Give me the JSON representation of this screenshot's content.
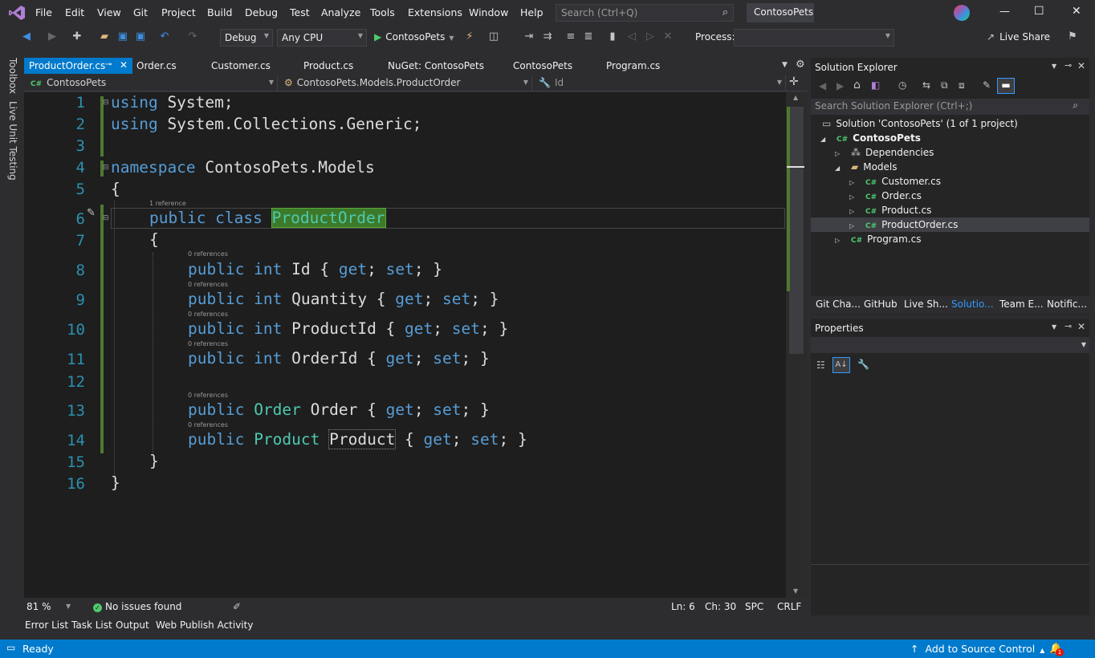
{
  "menu": {
    "items": [
      "File",
      "Edit",
      "View",
      "Git",
      "Project",
      "Build",
      "Debug",
      "Test",
      "Analyze",
      "Tools",
      "Extensions",
      "Window",
      "Help"
    ],
    "search_placeholder": "Search (Ctrl+Q)",
    "solution_name": "ContosoPets",
    "window_buttons": {
      "minimize": "—",
      "maximize": "☐",
      "close": "✕"
    }
  },
  "toolbar": {
    "configuration": "Debug",
    "platform": "Any CPU",
    "start_target": "ContosoPets",
    "process_label": "Process:",
    "process_value": "",
    "live_share": "Live Share"
  },
  "left_rail": {
    "toolbox": "Toolbox",
    "live_unit_testing": "Live Unit Testing"
  },
  "tabs": [
    "ProductOrder.cs",
    "Order.cs",
    "Customer.cs",
    "Product.cs",
    "NuGet: ContosoPets",
    "ContosoPets",
    "Program.cs"
  ],
  "navbar": {
    "project": "ContosoPets",
    "type": "ContosoPets.Models.ProductOrder",
    "member": "Id"
  },
  "code": {
    "line_numbers": [
      "1",
      "2",
      "3",
      "4",
      "5",
      "6",
      "7",
      "8",
      "9",
      "10",
      "11",
      "12",
      "13",
      "14",
      "15",
      "16"
    ],
    "refs": {
      "class": "1 reference",
      "id": "0 references",
      "quantity": "0 references",
      "productid": "0 references",
      "orderid": "0 references",
      "order": "0 references",
      "product": "0 references"
    },
    "lines": {
      "l1_kw": "using",
      "l1_rest": " System;",
      "l2_kw": "using",
      "l2_rest": " System.Collections.Generic;",
      "l4_kw": "namespace",
      "l4_rest": " ContosoPets.Models",
      "l5": "{",
      "l6_kw": "public class",
      "l6_name": "ProductOrder",
      "l7": "{",
      "l8_kw": "public int",
      "l8_name": " Id { ",
      "l8_get": "get",
      "l8_mid": "; ",
      "l8_set": "set",
      "l8_end": "; }",
      "l9_kw": "public int",
      "l9_name": " Quantity { ",
      "l9_get": "get",
      "l9_mid": "; ",
      "l9_set": "set",
      "l9_end": "; }",
      "l10_kw": "public int",
      "l10_name": " ProductId { ",
      "l10_get": "get",
      "l10_mid": "; ",
      "l10_set": "set",
      "l10_end": "; }",
      "l11_kw": "public int",
      "l11_name": " OrderId { ",
      "l11_get": "get",
      "l11_mid": "; ",
      "l11_set": "set",
      "l11_end": "; }",
      "l13_kw": "public",
      "l13_type": " Order",
      "l13_name": " Order { ",
      "l13_get": "get",
      "l13_mid": "; ",
      "l13_set": "set",
      "l13_end": "; }",
      "l14_kw": "public",
      "l14_type": " Product",
      "l14_name": "Product",
      "l14_open": " { ",
      "l14_get": "get",
      "l14_mid": "; ",
      "l14_set": "set",
      "l14_end": "; }",
      "l15": "}",
      "l16": "}"
    }
  },
  "editor_status": {
    "zoom": "81 %",
    "issues": "No issues found",
    "line": "Ln: 6",
    "col": "Ch: 30",
    "spacing": "SPC",
    "eol": "CRLF"
  },
  "bottom_tabs": [
    "Error List",
    "Task List",
    "Output",
    "Web Publish Activity"
  ],
  "status_bar": {
    "ready": "Ready",
    "source_control": "Add to Source Control",
    "notifications": "1"
  },
  "solution_explorer": {
    "title": "Solution Explorer",
    "search_placeholder": "Search Solution Explorer (Ctrl+;)",
    "solution": "Solution 'ContosoPets' (1 of 1 project)",
    "project": "ContosoPets",
    "dependencies": "Dependencies",
    "models": "Models",
    "files": [
      "Customer.cs",
      "Order.cs",
      "Product.cs",
      "ProductOrder.cs"
    ],
    "program": "Program.cs",
    "cs_badge": "C#",
    "bottom_tabs": [
      "Git Cha...",
      "GitHub",
      "Live Sh...",
      "Solutio...",
      "Team E...",
      "Notific..."
    ]
  },
  "properties": {
    "title": "Properties"
  }
}
